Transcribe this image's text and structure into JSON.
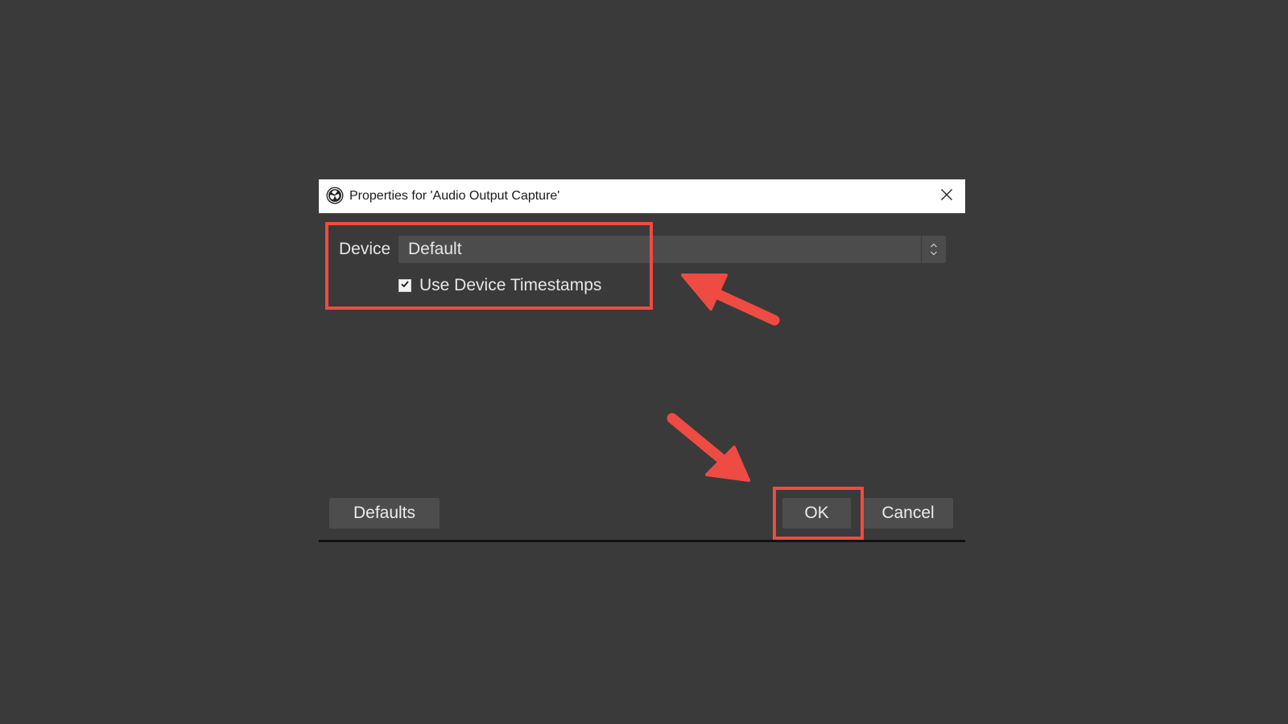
{
  "dialog": {
    "title": "Properties for 'Audio Output Capture'",
    "device_label": "Device",
    "device_value": "Default",
    "use_timestamps_label": "Use Device Timestamps",
    "use_timestamps_checked": true,
    "defaults_label": "Defaults",
    "ok_label": "OK",
    "cancel_label": "Cancel"
  },
  "icons": {
    "app": "obs-logo-icon",
    "close": "close-icon",
    "spinner": "updown-chevron-icon",
    "check": "check-icon"
  },
  "colors": {
    "background": "#3a3a3a",
    "titlebar": "#ffffff",
    "control": "#4c4c4c",
    "text": "#e6e6e6",
    "annotation": "#ee4b43"
  }
}
